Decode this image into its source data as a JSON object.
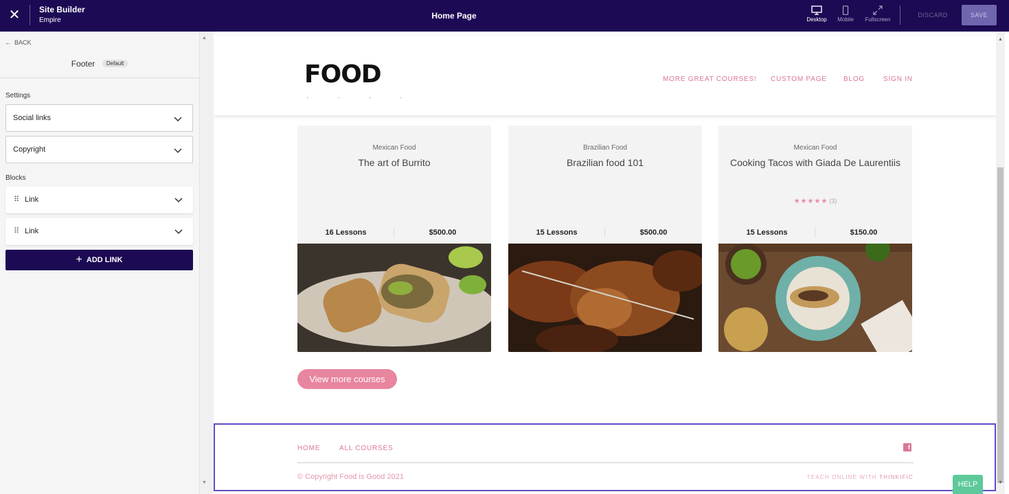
{
  "topbar": {
    "title": "Site Builder",
    "subtitle": "Empire",
    "page": "Home Page",
    "devices": [
      {
        "label": "Desktop",
        "icon": "monitor-icon"
      },
      {
        "label": "Mobile",
        "icon": "mobile-icon"
      },
      {
        "label": "Fullscreen",
        "icon": "expand-icon"
      }
    ],
    "discard": "DISCARD",
    "save": "SAVE",
    "colors": {
      "bar": "#1c0a54",
      "save_bg": "#6f66b0"
    }
  },
  "sidebar": {
    "back": "BACK",
    "title": "Footer",
    "badge": "Default",
    "settings_label": "Settings",
    "settings": [
      {
        "label": "Social links"
      },
      {
        "label": "Copyright"
      }
    ],
    "blocks_label": "Blocks",
    "blocks": [
      {
        "label": "Link"
      },
      {
        "label": "Link"
      }
    ],
    "add_link": "ADD LINK"
  },
  "preview": {
    "logo": "FOOD",
    "nav": [
      "MORE GREAT COURSES!",
      "CUSTOM PAGE",
      "BLOG",
      "SIGN IN"
    ],
    "courses": [
      {
        "category": "Mexican Food",
        "title": "The art of Burrito",
        "lessons": "16 Lessons",
        "price": "$500.00",
        "rating": "",
        "rating_count": ""
      },
      {
        "category": "Brazilian Food",
        "title": "Brazilian food 101",
        "lessons": "15 Lessons",
        "price": "$500.00",
        "rating": "",
        "rating_count": ""
      },
      {
        "category": "Mexican Food",
        "title": "Cooking Tacos with Giada De Laurentiis",
        "lessons": "15 Lessons",
        "price": "$150.00",
        "rating": "★★★★★",
        "rating_count": "(3)"
      }
    ],
    "view_more": "View more courses",
    "footer": {
      "links": [
        "HOME",
        "ALL COURSES"
      ],
      "copyright": "© Copyright Food is Good 2021",
      "teach_prefix": "TEACH ONLINE WITH",
      "teach_brand": "THINKIFIC"
    },
    "accent": "#e8859f"
  },
  "help": "HELP"
}
